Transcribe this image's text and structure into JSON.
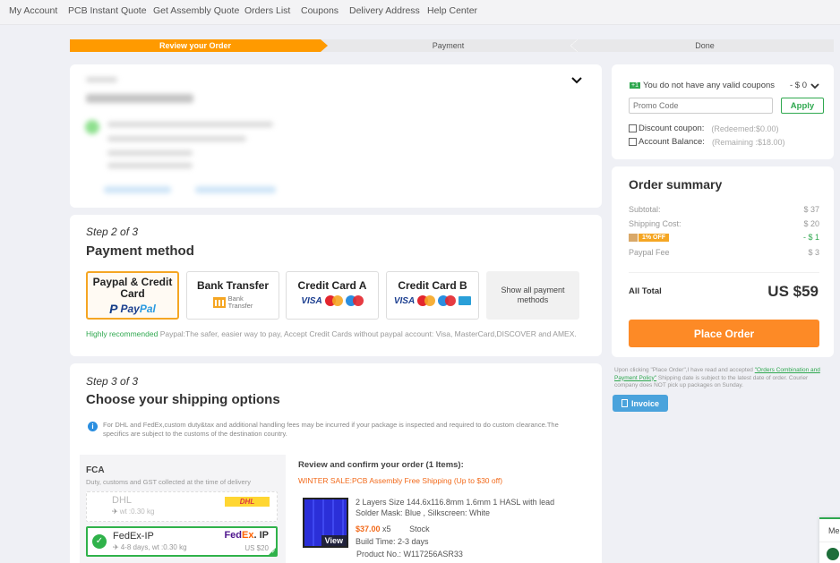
{
  "topnav": {
    "items": [
      "My Account",
      "PCB Instant Quote",
      "Get Assembly Quote",
      "Orders List",
      "Coupons",
      "Delivery Address",
      "Help Center"
    ]
  },
  "steps": [
    {
      "label": "Review your Order",
      "active": true
    },
    {
      "label": "Payment",
      "active": false
    },
    {
      "label": "Done",
      "active": false
    }
  ],
  "shipping_info": {
    "blurred": true
  },
  "payment": {
    "step": "Step 2 of 3",
    "title": "Payment method",
    "methods": [
      {
        "title": "Paypal & Credit Card",
        "logo": "PayPal",
        "logo_a": "Pay",
        "logo_b": "Pal",
        "selected": true
      },
      {
        "title": "Bank Transfer",
        "sub_1": "Bank",
        "sub_2": "Transfer",
        "selected": false
      },
      {
        "title": "Credit Card A",
        "cards": [
          "VISA",
          "mastercard",
          "maestro"
        ],
        "selected": false
      },
      {
        "title": "Credit Card B",
        "cards": [
          "VISA",
          "mastercard",
          "maestro",
          "CB"
        ],
        "selected": false
      }
    ],
    "show_all": "Show all payment methods",
    "note_highlight": "Highly recommended",
    "note_text": " Paypal:The safer, easier way to pay, Accept Credit Cards without paypal account: Visa, MasterCard,DISCOVER and AMEX."
  },
  "shipping": {
    "step": "Step 3 of 3",
    "title": "Choose your shipping options",
    "info": "For DHL and FedEx,custom duty&tax and additional handling fees may be incurred if your package is inspected and required to do custom clearance.The specifics are subject to the customs of the destination country.",
    "group_title": "FCA",
    "group_sub": "Duty, customs and GST collected at the time of delivery",
    "options": [
      {
        "name": "DHL",
        "detail": "wt :0.30 kg",
        "logo": "DHL",
        "price": "",
        "selected": false
      },
      {
        "name": "FedEx-IP",
        "detail": "4-8 days, wt :0.30 kg",
        "logo_fe": "Fed",
        "logo_ex": "Ex",
        "logo_ip": ". IP",
        "price": "US $20",
        "selected": true
      }
    ]
  },
  "review": {
    "title": "Review and confirm your order (1 Items):",
    "promo": "WINTER SALE:PCB Assembly Free Shipping (Up to $30 off)",
    "item": {
      "line1": "2 Layers Size 144.6x116.8mm 1.6mm 1 HASL with lead",
      "line2": "Solder Mask: Blue , Silkscreen: White",
      "price": "$37.00",
      "qty": "x5",
      "stock": "Stock",
      "build_time": "Build Time: 2-3 days",
      "product_no": "Product No.: W117256ASR33",
      "view_label": "View"
    }
  },
  "coupons": {
    "tag": "+1",
    "message": "You do not have any valid coupons",
    "amount": "- $ 0",
    "promo_placeholder": "Promo Code",
    "apply_label": "Apply",
    "discount_label": "Discount coupon:",
    "discount_note": "(Redeemed:$0.00)",
    "balance_label": "Account Balance:",
    "balance_note": "(Remaining :$18.00)"
  },
  "summary": {
    "title": "Order summary",
    "subtotal_label": "Subtotal:",
    "subtotal": "$ 37",
    "shipping_label": "Shipping Cost:",
    "shipping": "$ 20",
    "discount_badge": "1% OFF",
    "discount": "- $ 1",
    "paypal_fee_label": "Paypal Fee",
    "paypal_fee": "$ 3",
    "total_label": "All Total",
    "total": "US $59",
    "place_order": "Place Order"
  },
  "terms": {
    "prefix": "Upon clicking \"Place Order\",I have read and accepted ",
    "link": "\"Orders Combination and Payment Policy\"",
    "suffix": " Shipping date is subject to the latest date of order. Courier company does NOT pick up packages on Sunday."
  },
  "invoice_label": "Invoice",
  "chat": {
    "label": "Me"
  },
  "colors": {
    "accent_orange": "#ff9a00",
    "place_order": "#fd8a26",
    "green": "#2fa84f",
    "invoice_blue": "#4aa3dc"
  }
}
